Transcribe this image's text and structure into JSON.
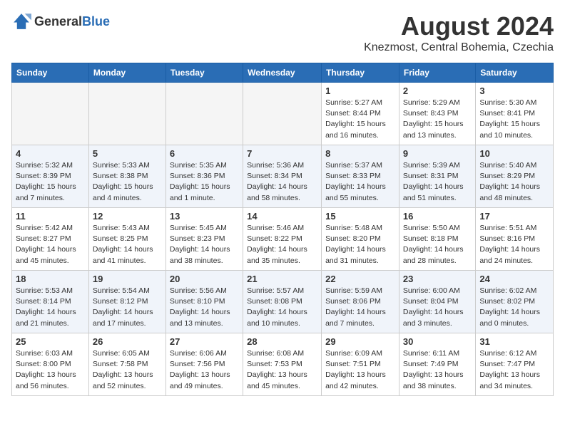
{
  "header": {
    "logo_general": "General",
    "logo_blue": "Blue",
    "title": "August 2024",
    "location": "Knezmost, Central Bohemia, Czechia"
  },
  "weekdays": [
    "Sunday",
    "Monday",
    "Tuesday",
    "Wednesday",
    "Thursday",
    "Friday",
    "Saturday"
  ],
  "weeks": [
    [
      {
        "day": "",
        "info": ""
      },
      {
        "day": "",
        "info": ""
      },
      {
        "day": "",
        "info": ""
      },
      {
        "day": "",
        "info": ""
      },
      {
        "day": "1",
        "info": "Sunrise: 5:27 AM\nSunset: 8:44 PM\nDaylight: 15 hours\nand 16 minutes."
      },
      {
        "day": "2",
        "info": "Sunrise: 5:29 AM\nSunset: 8:43 PM\nDaylight: 15 hours\nand 13 minutes."
      },
      {
        "day": "3",
        "info": "Sunrise: 5:30 AM\nSunset: 8:41 PM\nDaylight: 15 hours\nand 10 minutes."
      }
    ],
    [
      {
        "day": "4",
        "info": "Sunrise: 5:32 AM\nSunset: 8:39 PM\nDaylight: 15 hours\nand 7 minutes."
      },
      {
        "day": "5",
        "info": "Sunrise: 5:33 AM\nSunset: 8:38 PM\nDaylight: 15 hours\nand 4 minutes."
      },
      {
        "day": "6",
        "info": "Sunrise: 5:35 AM\nSunset: 8:36 PM\nDaylight: 15 hours\nand 1 minute."
      },
      {
        "day": "7",
        "info": "Sunrise: 5:36 AM\nSunset: 8:34 PM\nDaylight: 14 hours\nand 58 minutes."
      },
      {
        "day": "8",
        "info": "Sunrise: 5:37 AM\nSunset: 8:33 PM\nDaylight: 14 hours\nand 55 minutes."
      },
      {
        "day": "9",
        "info": "Sunrise: 5:39 AM\nSunset: 8:31 PM\nDaylight: 14 hours\nand 51 minutes."
      },
      {
        "day": "10",
        "info": "Sunrise: 5:40 AM\nSunset: 8:29 PM\nDaylight: 14 hours\nand 48 minutes."
      }
    ],
    [
      {
        "day": "11",
        "info": "Sunrise: 5:42 AM\nSunset: 8:27 PM\nDaylight: 14 hours\nand 45 minutes."
      },
      {
        "day": "12",
        "info": "Sunrise: 5:43 AM\nSunset: 8:25 PM\nDaylight: 14 hours\nand 41 minutes."
      },
      {
        "day": "13",
        "info": "Sunrise: 5:45 AM\nSunset: 8:23 PM\nDaylight: 14 hours\nand 38 minutes."
      },
      {
        "day": "14",
        "info": "Sunrise: 5:46 AM\nSunset: 8:22 PM\nDaylight: 14 hours\nand 35 minutes."
      },
      {
        "day": "15",
        "info": "Sunrise: 5:48 AM\nSunset: 8:20 PM\nDaylight: 14 hours\nand 31 minutes."
      },
      {
        "day": "16",
        "info": "Sunrise: 5:50 AM\nSunset: 8:18 PM\nDaylight: 14 hours\nand 28 minutes."
      },
      {
        "day": "17",
        "info": "Sunrise: 5:51 AM\nSunset: 8:16 PM\nDaylight: 14 hours\nand 24 minutes."
      }
    ],
    [
      {
        "day": "18",
        "info": "Sunrise: 5:53 AM\nSunset: 8:14 PM\nDaylight: 14 hours\nand 21 minutes."
      },
      {
        "day": "19",
        "info": "Sunrise: 5:54 AM\nSunset: 8:12 PM\nDaylight: 14 hours\nand 17 minutes."
      },
      {
        "day": "20",
        "info": "Sunrise: 5:56 AM\nSunset: 8:10 PM\nDaylight: 14 hours\nand 13 minutes."
      },
      {
        "day": "21",
        "info": "Sunrise: 5:57 AM\nSunset: 8:08 PM\nDaylight: 14 hours\nand 10 minutes."
      },
      {
        "day": "22",
        "info": "Sunrise: 5:59 AM\nSunset: 8:06 PM\nDaylight: 14 hours\nand 7 minutes."
      },
      {
        "day": "23",
        "info": "Sunrise: 6:00 AM\nSunset: 8:04 PM\nDaylight: 14 hours\nand 3 minutes."
      },
      {
        "day": "24",
        "info": "Sunrise: 6:02 AM\nSunset: 8:02 PM\nDaylight: 14 hours\nand 0 minutes."
      }
    ],
    [
      {
        "day": "25",
        "info": "Sunrise: 6:03 AM\nSunset: 8:00 PM\nDaylight: 13 hours\nand 56 minutes."
      },
      {
        "day": "26",
        "info": "Sunrise: 6:05 AM\nSunset: 7:58 PM\nDaylight: 13 hours\nand 52 minutes."
      },
      {
        "day": "27",
        "info": "Sunrise: 6:06 AM\nSunset: 7:56 PM\nDaylight: 13 hours\nand 49 minutes."
      },
      {
        "day": "28",
        "info": "Sunrise: 6:08 AM\nSunset: 7:53 PM\nDaylight: 13 hours\nand 45 minutes."
      },
      {
        "day": "29",
        "info": "Sunrise: 6:09 AM\nSunset: 7:51 PM\nDaylight: 13 hours\nand 42 minutes."
      },
      {
        "day": "30",
        "info": "Sunrise: 6:11 AM\nSunset: 7:49 PM\nDaylight: 13 hours\nand 38 minutes."
      },
      {
        "day": "31",
        "info": "Sunrise: 6:12 AM\nSunset: 7:47 PM\nDaylight: 13 hours\nand 34 minutes."
      }
    ]
  ]
}
